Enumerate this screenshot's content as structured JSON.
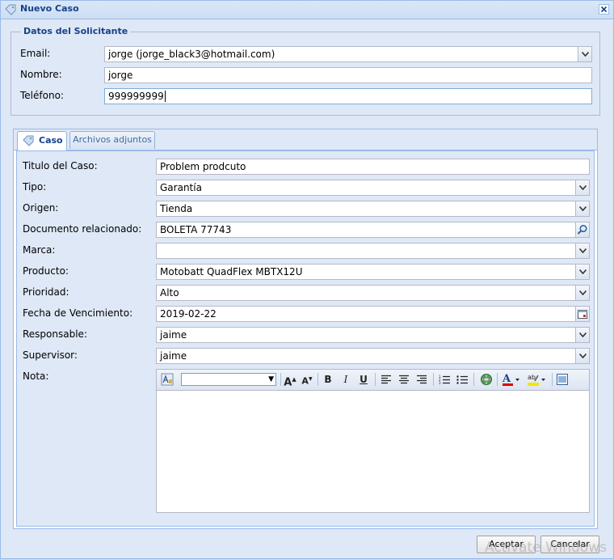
{
  "window": {
    "title": "Nuevo Caso"
  },
  "requester": {
    "legend": "Datos del Solicitante",
    "email_label": "Email:",
    "email_value": "jorge (jorge_black3@hotmail.com)",
    "name_label": "Nombre:",
    "name_value": "jorge",
    "phone_label": "Teléfono:",
    "phone_value": "999999999"
  },
  "tabs": [
    {
      "label": "Caso",
      "active": true
    },
    {
      "label": "Archivos adjuntos",
      "active": false
    }
  ],
  "case": {
    "title_label": "Titulo del Caso:",
    "title_value": "Problem prodcuto",
    "type_label": "Tipo:",
    "type_value": "Garantía",
    "origin_label": "Origen:",
    "origin_value": "Tienda",
    "doc_label": "Documento relacionado:",
    "doc_value": "BOLETA 77743",
    "brand_label": "Marca:",
    "brand_value": "",
    "product_label": "Producto:",
    "product_value": "Motobatt QuadFlex MBTX12U",
    "priority_label": "Prioridad:",
    "priority_value": "Alto",
    "due_label": "Fecha de Vencimiento:",
    "due_value": "2019-02-22",
    "owner_label": "Responsable:",
    "owner_value": "jaime",
    "supervisor_label": "Supervisor:",
    "supervisor_value": "jaime",
    "note_label": "Nota:"
  },
  "buttons": {
    "ok": "Aceptar",
    "cancel": "Cancelar"
  },
  "watermark": "Activate Windows",
  "colors": {
    "header_text": "#15428b",
    "panel_bg": "#dfe8f6",
    "border": "#99bbe8"
  },
  "icons": [
    "tag-icon",
    "close-icon",
    "chevron-down-icon",
    "search-icon",
    "calendar-icon",
    "font-increase-icon",
    "font-decrease-icon",
    "bold-icon",
    "italic-icon",
    "underline-icon",
    "align-left-icon",
    "align-center-icon",
    "align-right-icon",
    "ordered-list-icon",
    "unordered-list-icon",
    "link-icon",
    "font-color-icon",
    "highlight-icon",
    "source-edit-icon"
  ]
}
